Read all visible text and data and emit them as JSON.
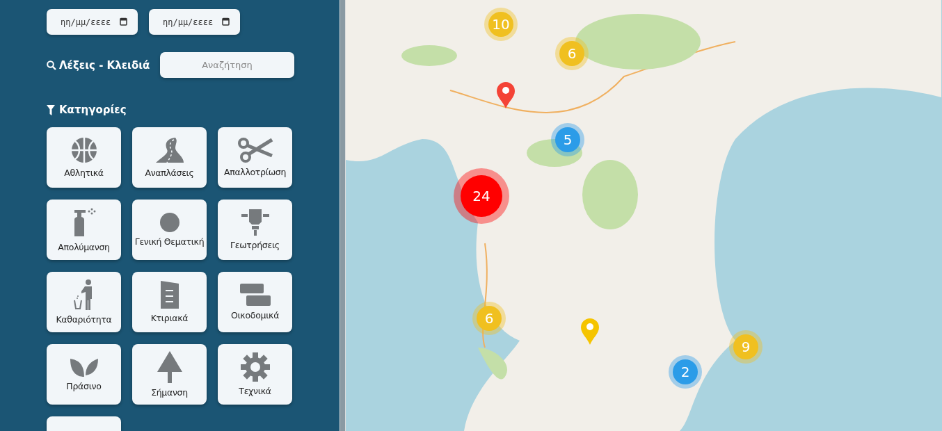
{
  "filters": {
    "date_from": {
      "placeholder": "ηη/μμ/εεεε"
    },
    "date_to": {
      "placeholder": "ηη/μμ/εεεε"
    },
    "keywords": {
      "label": "Λέξεις - Κλειδιά",
      "placeholder": "Αναζήτηση"
    },
    "categories_title": "Κατηγορίες",
    "categories": [
      {
        "kind": "ball",
        "label": "Αθλητικά"
      },
      {
        "kind": "road",
        "label": "Αναπλάσεις"
      },
      {
        "kind": "scissors",
        "label": "Απαλλοτρίωση"
      },
      {
        "kind": "spray",
        "label": "Απολύμανση"
      },
      {
        "kind": "circle",
        "label": "Γενική Θεματική"
      },
      {
        "kind": "drill",
        "label": "Γεωτρήσεις"
      },
      {
        "kind": "bin",
        "label": "Καθαριότητα"
      },
      {
        "kind": "building",
        "label": "Κτιριακά"
      },
      {
        "kind": "bricks",
        "label": "Οικοδομικά"
      },
      {
        "kind": "leaves",
        "label": "Πράσινο"
      },
      {
        "kind": "sign",
        "label": "Σήμανση"
      },
      {
        "kind": "gear",
        "label": "Τεχνικά"
      },
      {
        "kind": "partial"
      }
    ]
  },
  "map": {
    "markers": [
      {
        "kind": "cluster",
        "count": "10",
        "color": "#f0c020"
      },
      {
        "kind": "cluster",
        "count": "6",
        "color": "#f0c020"
      },
      {
        "kind": "pin",
        "color": "#f44336"
      },
      {
        "kind": "cluster",
        "count": "5",
        "color": "#2b9ce8"
      },
      {
        "kind": "cluster",
        "count": "24",
        "color": "#ff0000"
      },
      {
        "kind": "cluster",
        "count": "6",
        "color": "#f0c020"
      },
      {
        "kind": "pin",
        "color": "#f5c400"
      },
      {
        "kind": "cluster",
        "count": "9",
        "color": "#f0c020"
      },
      {
        "kind": "cluster",
        "count": "2",
        "color": "#2b9ce8"
      }
    ]
  }
}
